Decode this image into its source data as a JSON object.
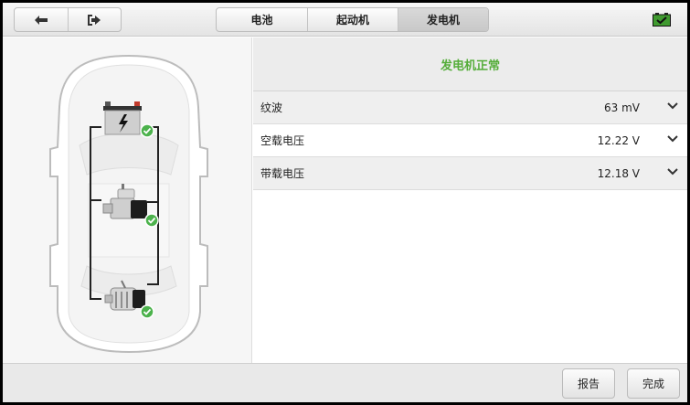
{
  "tabs": [
    {
      "label": "电池",
      "active": false
    },
    {
      "label": "起动机",
      "active": false
    },
    {
      "label": "发电机",
      "active": true
    }
  ],
  "icons": {
    "back": "back-arrow-icon",
    "exit": "exit-icon",
    "battery_status": "battery-ok-icon",
    "expand": "chevron-down-icon"
  },
  "status": {
    "text": "发电机正常",
    "color": "#55ad3a"
  },
  "results": [
    {
      "label": "纹波",
      "value": "63 mV"
    },
    {
      "label": "空载电压",
      "value": "12.22 V"
    },
    {
      "label": "带载电压",
      "value": "12.18 V"
    }
  ],
  "footer": {
    "report_label": "报告",
    "done_label": "完成"
  },
  "components": [
    {
      "name": "battery",
      "status": "ok"
    },
    {
      "name": "starter",
      "status": "ok"
    },
    {
      "name": "alternator",
      "status": "ok"
    }
  ]
}
